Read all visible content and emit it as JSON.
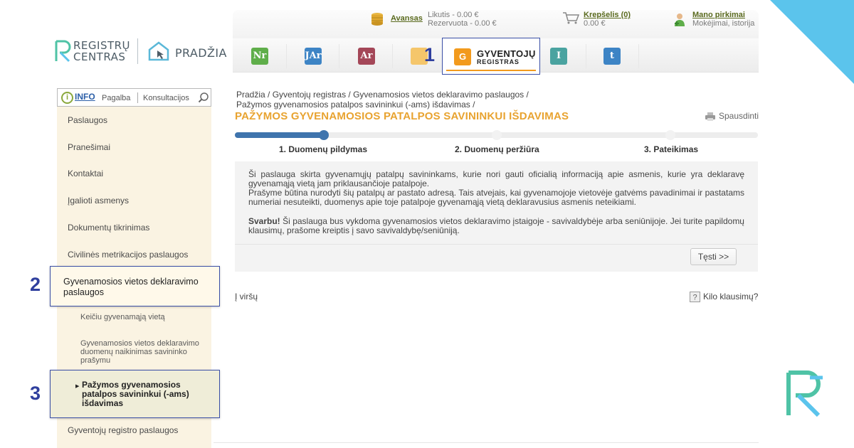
{
  "header": {
    "logo_text_line1": "REGISTRŲ",
    "logo_text_line2": "CENTRAS",
    "home_label": "PRADŽIA",
    "advance": {
      "label": "Avansas",
      "balance": "Likutis - 0.00 €",
      "reserved": "Rezervuota - 0.00 €"
    },
    "cart": {
      "label": "Krepšelis (0)",
      "amount": "0.00 €"
    },
    "purchases": {
      "label": "Mano pirkimai",
      "sub": "Mokėjimai, istorija"
    },
    "tabs": [
      {
        "icon": "nekilnojamojo-turto-icon",
        "color": "#5fae4a",
        "glyph": "Nr"
      },
      {
        "icon": "juridiniu-asmenu-icon",
        "color": "#3d84c5",
        "glyph": "JAr"
      },
      {
        "icon": "adresu-registras-icon",
        "color": "#a44758",
        "glyph": "Ar"
      },
      {
        "icon": "registras-icon",
        "color": "#f5c66b",
        "glyph": ""
      },
      {
        "icon": "isankstine-icon",
        "color": "#4aa3a0",
        "glyph": "I"
      },
      {
        "icon": "testamentu-icon",
        "color": "#3d84c5",
        "glyph": "t"
      }
    ],
    "active_tab": {
      "line1": "GYVENTOJŲ",
      "line2": "REGISTRAS",
      "glyph": "G",
      "color": "#f29a1d"
    }
  },
  "callouts": {
    "one": "1",
    "two": "2",
    "three": "3"
  },
  "sidebar": {
    "info": "INFO",
    "help": "Pagalba",
    "consult": "Konsultacijos",
    "items": [
      "Paslaugos",
      "Pranešimai",
      "Kontaktai",
      "Įgalioti asmenys",
      "Dokumentų tikrinimas",
      "Civilinės metrikacijos paslaugos"
    ],
    "highlight_item": "Gyvenamosios vietos deklaravimo paslaugos",
    "sub_items": [
      "Keičiu gyvenamąją vietą",
      "Gyvenamosios vietos deklaravimo duomenų naikinimas savininko prašymu"
    ],
    "active_sub": "Pažymos gyvenamosios patalpos savininkui (-ams) išdavimas",
    "last_item": "Gyventojų registro paslaugos"
  },
  "main": {
    "breadcrumb_line1": "Pradžia / Gyventojų registras / Gyvenamosios vietos deklaravimo paslaugos /",
    "breadcrumb_line2": "Pažymos gyvenamosios patalpos savininkui (-ams) išdavimas /",
    "title": "PAŽYMOS GYVENAMOSIOS PATALPOS SAVININKUI IŠDAVIMAS",
    "print": "Spausdinti",
    "progress_fraction": 0.17,
    "steps": [
      "1. Duomenų pildymas",
      "2. Duomenų peržiūra",
      "3. Pateikimas"
    ],
    "para1": "Ši paslauga skirta gyvenamųjų patalpų savininkams, kurie nori gauti oficialią informaciją apie asmenis, kurie yra deklaravę gyvenamąją vietą jam priklausančioje patalpoje.",
    "para2": "Prašyme būtina nurodyti šių patalpų ar pastato adresą. Tais atvejais, kai gyvenamojoje vietovėje gatvėms pavadinimai ir pastatams numeriai nesuteikti, duomenys apie toje patalpoje gyvenamąją vietą deklaravusius asmenis neteikiami.",
    "important_label": "Svarbu!",
    "important_text": "Ši paslauga bus vykdoma gyvenamosios vietos deklaravimo įstaigoje - savivaldybėje arba seniūnijoje. Jei turite papildomų klausimų, prašome kreiptis į savo savivaldybę/seniūniją.",
    "continue_button": "Tęsti >>",
    "to_top": "Į viršų",
    "questions": "Kilo klausimų?"
  },
  "colors": {
    "accent_blue": "#3a4fa6",
    "title_orange": "#e8a330",
    "corner": "#5bc4ec"
  }
}
